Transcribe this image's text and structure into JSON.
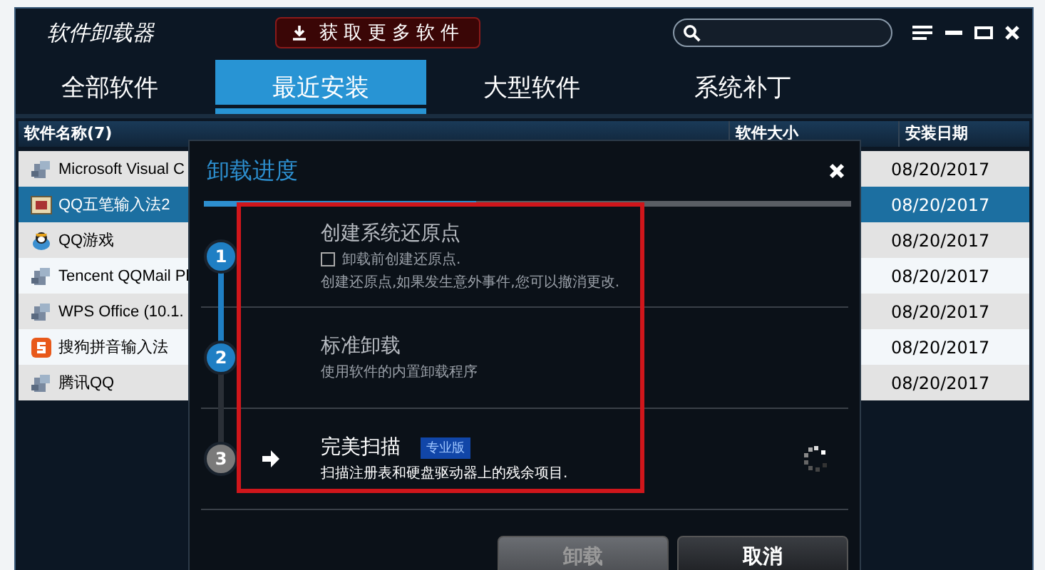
{
  "window": {
    "title": "软件卸载器",
    "get_more_button": "获取更多软件"
  },
  "tabs": [
    {
      "label": "全部软件",
      "selected": false
    },
    {
      "label": "最近安装",
      "selected": true
    },
    {
      "label": "大型软件",
      "selected": false
    },
    {
      "label": "系统补丁",
      "selected": false
    }
  ],
  "table": {
    "columns": [
      "软件名称(7)",
      "软件大小",
      "安装日期"
    ],
    "rows": [
      {
        "kind": "installer",
        "name": "Microsoft Visual C",
        "date": "08/20/2017",
        "selected": false
      },
      {
        "kind": "ime",
        "name": "QQ五笔输入法2",
        "date": "08/20/2017",
        "selected": true
      },
      {
        "kind": "game",
        "name": "QQ游戏",
        "date": "08/20/2017",
        "selected": false
      },
      {
        "kind": "installer",
        "name": "Tencent QQMail Pl",
        "date": "08/20/2017",
        "selected": false
      },
      {
        "kind": "installer",
        "name": "WPS Office (10.1.",
        "date": "08/20/2017",
        "selected": false
      },
      {
        "kind": "sogou",
        "name": "搜狗拼音输入法",
        "date": "08/20/2017",
        "selected": false
      },
      {
        "kind": "installer",
        "name": "腾讯QQ",
        "date": "08/20/2017",
        "selected": false
      }
    ]
  },
  "dialog": {
    "title": "卸载进度",
    "progress": {
      "level": 0.42
    },
    "steps": [
      {
        "number": "1",
        "completed": true,
        "current": false,
        "title": "创建系统还原点",
        "checkbox": {
          "label": "卸载前创建还原点.",
          "checked": false
        },
        "description": "创建还原点,如果发生意外事件,您可以撤消更改."
      },
      {
        "number": "2",
        "completed": true,
        "current": false,
        "title": "标准卸载",
        "description": "使用软件的内置卸载程序"
      },
      {
        "number": "3",
        "completed": false,
        "current": true,
        "title": "完美扫描",
        "badge": "专业版",
        "description": "扫描注册表和硬盘驱动器上的残余项目."
      }
    ],
    "buttons": [
      {
        "label": "卸载",
        "disabled": true
      },
      {
        "label": "取消",
        "disabled": false
      }
    ]
  }
}
